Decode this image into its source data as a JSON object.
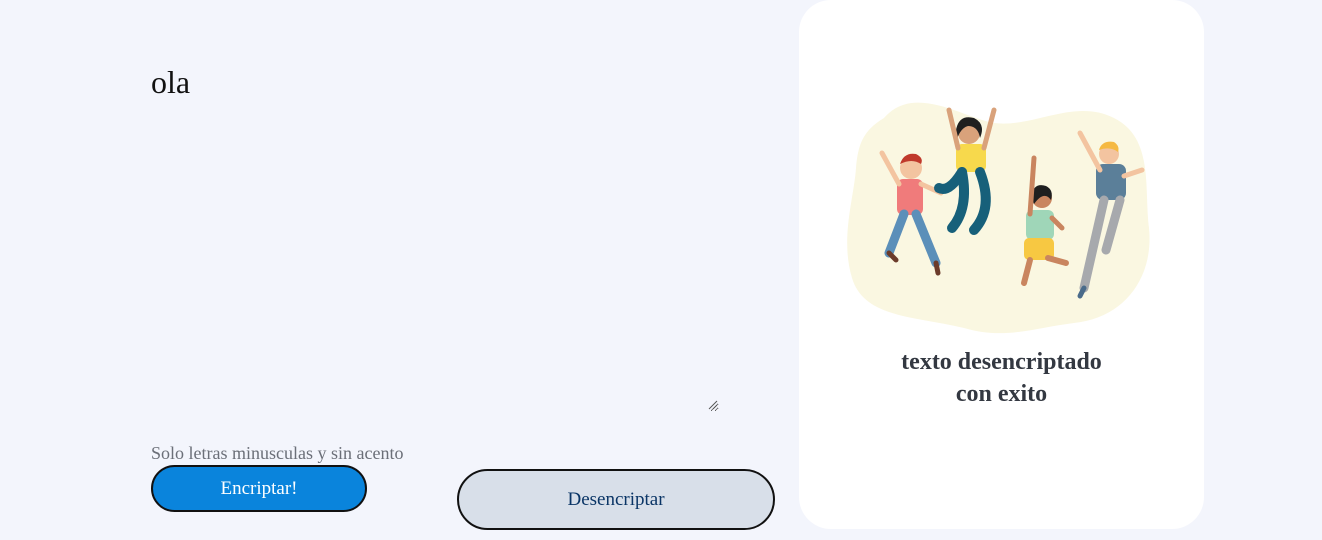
{
  "input": {
    "value": "ola",
    "hint": "Solo letras minusculas y sin acento"
  },
  "buttons": {
    "encrypt_label": "Encriptar!",
    "decrypt_label": "Desencriptar"
  },
  "result": {
    "line1": "texto desencriptado",
    "line2": "con exito",
    "illustration": "people-jumping-illustration"
  },
  "colors": {
    "page_background": "#f3f5fc",
    "card_background": "#ffffff",
    "encrypt_button": "#0a84dc",
    "decrypt_button": "#d8dfe9",
    "decrypt_text": "#0a3566",
    "blob": "#faf7e1"
  }
}
